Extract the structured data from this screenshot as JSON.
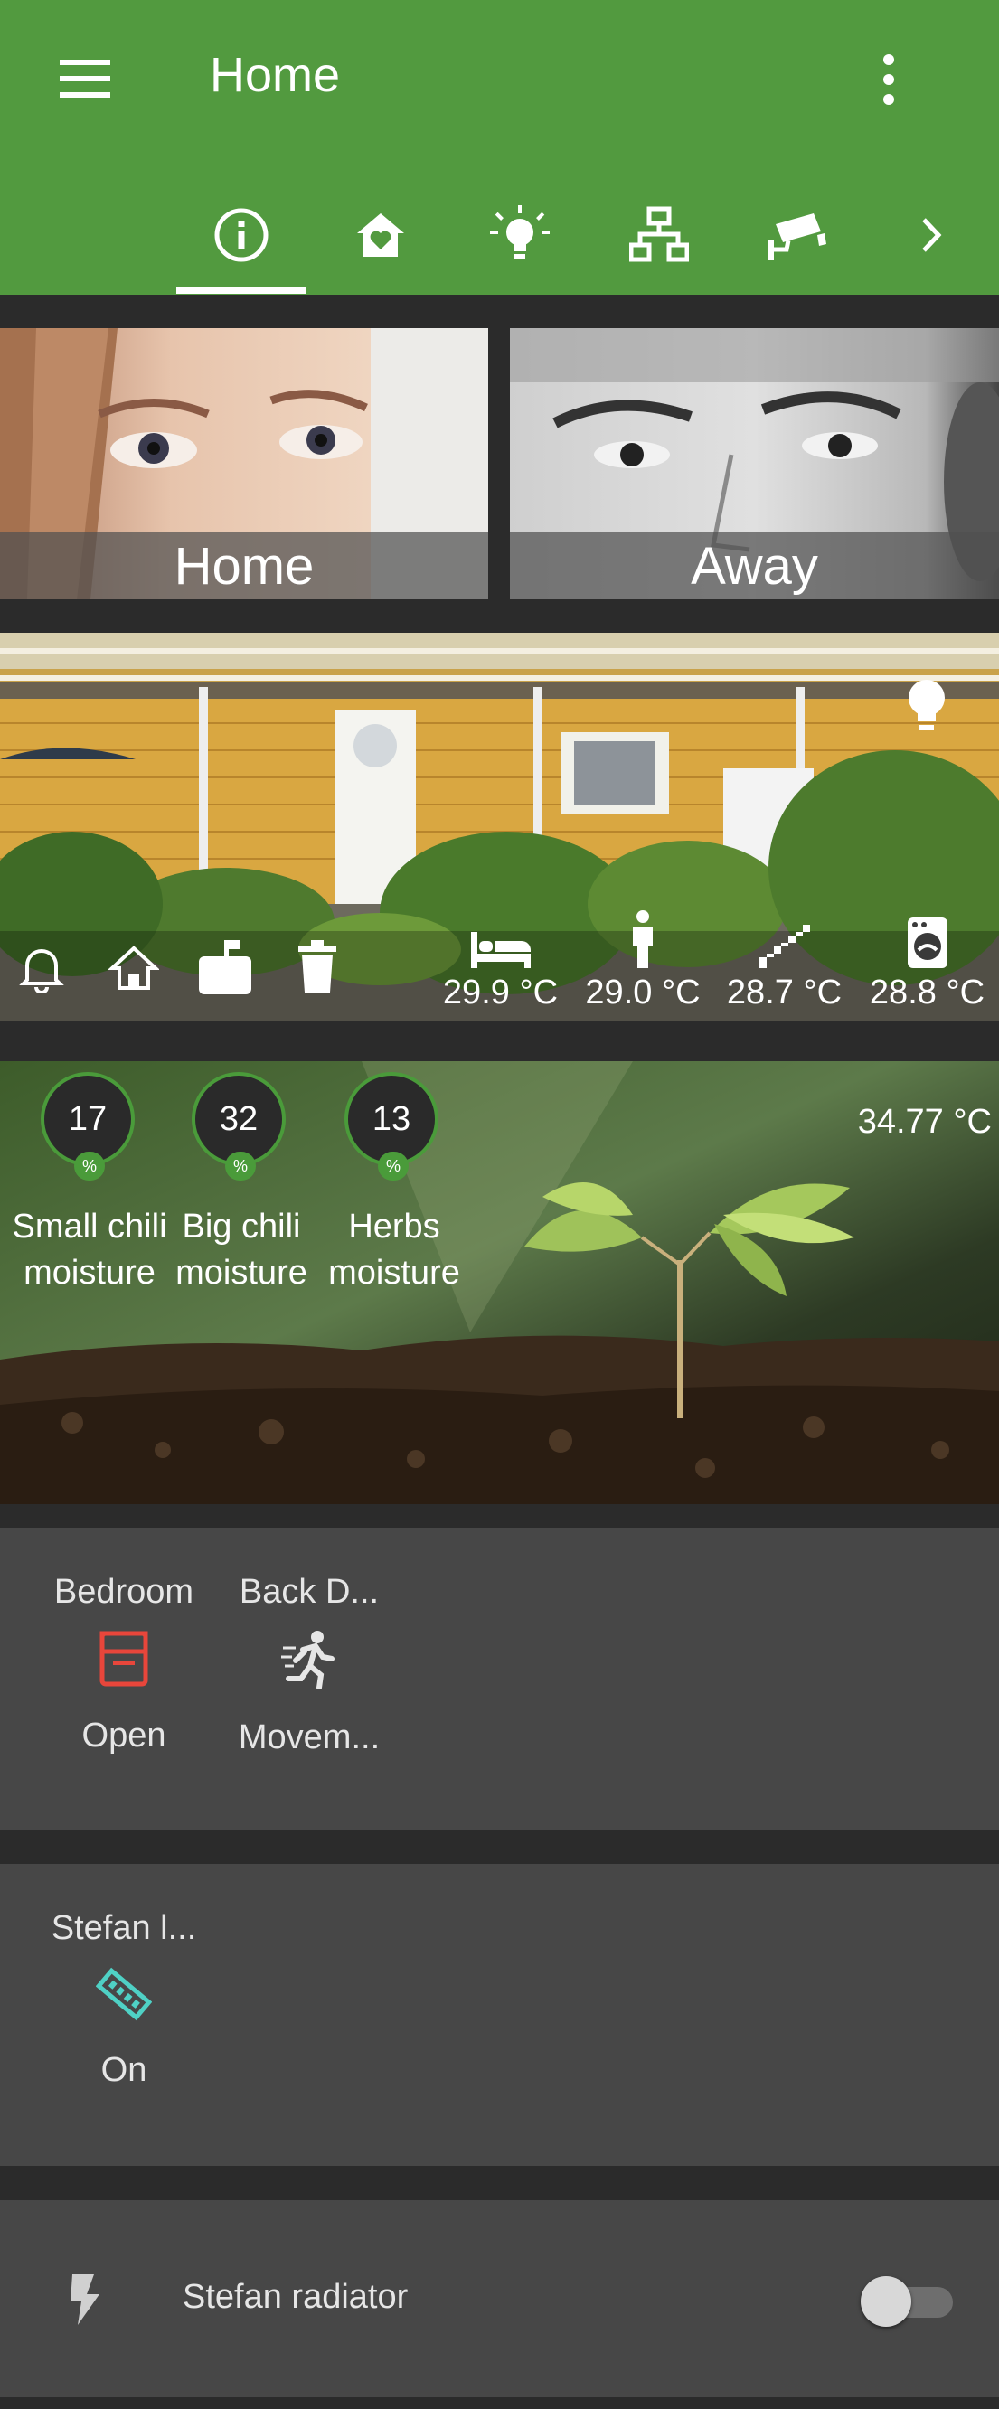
{
  "appbar": {
    "title": "Home"
  },
  "tabs": [
    {
      "icon": "info-icon"
    },
    {
      "icon": "home-heart-icon"
    },
    {
      "icon": "lightbulb-icon"
    },
    {
      "icon": "network-icon"
    },
    {
      "icon": "cctv-icon"
    },
    {
      "icon": "chevron-right-icon"
    }
  ],
  "persons": [
    {
      "label": "Home"
    },
    {
      "label": "Away"
    }
  ],
  "house": {
    "sensors": [
      {
        "icon": "bed-icon",
        "value": "29.9 °C"
      },
      {
        "icon": "human-icon",
        "value": "29.0 °C"
      },
      {
        "icon": "stairs-icon",
        "value": "28.7 °C"
      },
      {
        "icon": "washing-machine-icon",
        "value": "28.8 °C"
      }
    ]
  },
  "garden": {
    "temperature": "34.77 °C",
    "gauges": [
      {
        "value": "17",
        "unit": "%",
        "label_line1": "Small chili",
        "label_line2": "moisture"
      },
      {
        "value": "32",
        "unit": "%",
        "label_line1": "Big chili",
        "label_line2": "moisture"
      },
      {
        "value": "13",
        "unit": "%",
        "label_line1": "Herbs",
        "label_line2": "moisture"
      }
    ]
  },
  "glance1": {
    "entities": [
      {
        "name": "Bedroom",
        "state": "Open",
        "icon": "window-open-icon",
        "color": "#e8463b"
      },
      {
        "name": "Back D...",
        "state": "Movem...",
        "icon": "run-icon",
        "color": "#e6e6e6"
      }
    ]
  },
  "glance2": {
    "entities": [
      {
        "name": "Stefan l...",
        "state": "On",
        "icon": "led-strip-icon",
        "color": "#4fd1c5"
      }
    ]
  },
  "toggle_row": {
    "label": "Stefan radiator",
    "icon": "flash-icon",
    "state": "off"
  },
  "colors": {
    "primary": "#529a3f",
    "card": "#474747",
    "background": "#2b2b2b"
  }
}
